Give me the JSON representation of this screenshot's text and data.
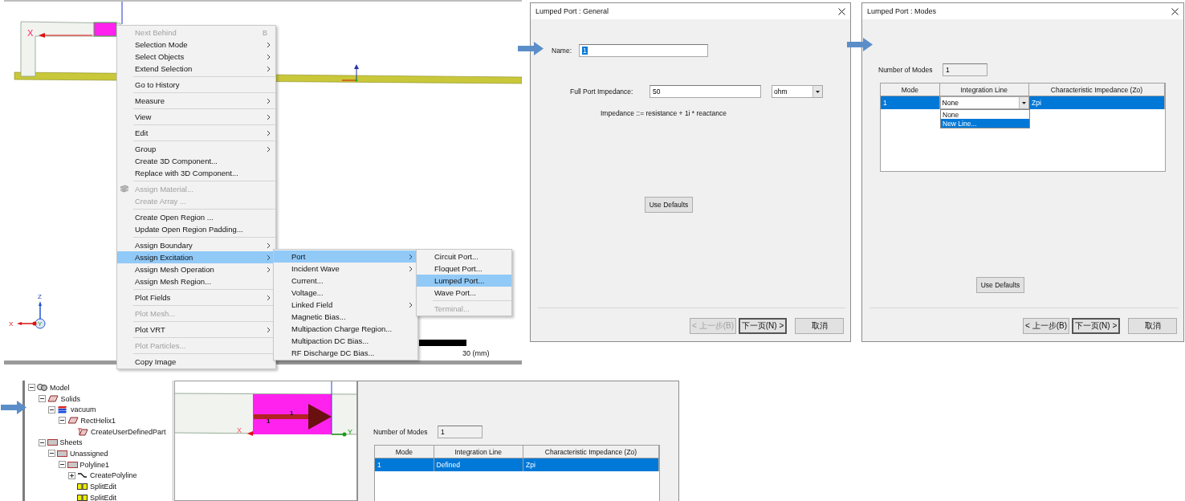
{
  "viewport": {
    "model_axis_label": "X",
    "triad_labels": [
      "Z",
      "X",
      "Y"
    ],
    "scale_label": "30 (mm)"
  },
  "context_menu": {
    "items": [
      {
        "kind": "item",
        "label": "Next Behind",
        "shortcut": "B",
        "disabled": true,
        "submenu": false,
        "selected": false
      },
      {
        "kind": "item",
        "label": "Selection Mode",
        "disabled": false,
        "submenu": true,
        "selected": false
      },
      {
        "kind": "item",
        "label": "Select Objects",
        "disabled": false,
        "submenu": true,
        "selected": false
      },
      {
        "kind": "item",
        "label": "Extend Selection",
        "disabled": false,
        "submenu": true,
        "selected": false
      },
      {
        "kind": "separator"
      },
      {
        "kind": "item",
        "label": "Go to History",
        "disabled": false,
        "submenu": false,
        "selected": false
      },
      {
        "kind": "separator"
      },
      {
        "kind": "item",
        "label": "Measure",
        "disabled": false,
        "submenu": true,
        "selected": false
      },
      {
        "kind": "separator"
      },
      {
        "kind": "item",
        "label": "View",
        "disabled": false,
        "submenu": true,
        "selected": false
      },
      {
        "kind": "separator"
      },
      {
        "kind": "item",
        "label": "Edit",
        "disabled": false,
        "submenu": true,
        "selected": false
      },
      {
        "kind": "separator"
      },
      {
        "kind": "item",
        "label": "Group",
        "disabled": false,
        "submenu": true,
        "selected": false
      },
      {
        "kind": "item",
        "label": "Create 3D Component...",
        "disabled": false,
        "submenu": false,
        "selected": false
      },
      {
        "kind": "item",
        "label": "Replace with 3D Component...",
        "disabled": false,
        "submenu": false,
        "selected": false
      },
      {
        "kind": "separator"
      },
      {
        "kind": "icon_item",
        "label": "Assign Material...",
        "disabled": true,
        "submenu": false,
        "selected": false
      },
      {
        "kind": "item",
        "label": "Create Array ...",
        "disabled": true,
        "submenu": false,
        "selected": false
      },
      {
        "kind": "separator"
      },
      {
        "kind": "item",
        "label": "Create Open Region ...",
        "disabled": false,
        "submenu": false,
        "selected": false
      },
      {
        "kind": "item",
        "label": "Update Open Region Padding...",
        "disabled": false,
        "submenu": false,
        "selected": false
      },
      {
        "kind": "separator"
      },
      {
        "kind": "item",
        "label": "Assign Boundary",
        "disabled": false,
        "submenu": true,
        "selected": false
      },
      {
        "kind": "item",
        "label": "Assign Excitation",
        "disabled": false,
        "submenu": true,
        "selected": true
      },
      {
        "kind": "item",
        "label": "Assign Mesh Operation",
        "disabled": false,
        "submenu": true,
        "selected": false
      },
      {
        "kind": "item",
        "label": "Assign Mesh Region...",
        "disabled": false,
        "submenu": false,
        "selected": false
      },
      {
        "kind": "separator"
      },
      {
        "kind": "item",
        "label": "Plot Fields",
        "disabled": false,
        "submenu": true,
        "selected": false
      },
      {
        "kind": "separator"
      },
      {
        "kind": "item",
        "label": "Plot Mesh...",
        "disabled": true,
        "submenu": false,
        "selected": false
      },
      {
        "kind": "separator"
      },
      {
        "kind": "item",
        "label": "Plot VRT",
        "disabled": false,
        "submenu": true,
        "selected": false
      },
      {
        "kind": "separator"
      },
      {
        "kind": "item",
        "label": "Plot Particles...",
        "disabled": true,
        "submenu": false,
        "selected": false
      },
      {
        "kind": "separator"
      },
      {
        "kind": "item",
        "label": "Copy Image",
        "disabled": false,
        "submenu": false,
        "selected": false
      }
    ]
  },
  "excitation_submenu": {
    "items": [
      {
        "kind": "item",
        "label": "Port",
        "disabled": false,
        "submenu": true,
        "selected": true
      },
      {
        "kind": "item",
        "label": "Incident Wave",
        "disabled": false,
        "submenu": true,
        "selected": false
      },
      {
        "kind": "item",
        "label": "Current...",
        "disabled": false,
        "submenu": false,
        "selected": false
      },
      {
        "kind": "item",
        "label": "Voltage...",
        "disabled": false,
        "submenu": false,
        "selected": false
      },
      {
        "kind": "item",
        "label": "Linked Field",
        "disabled": false,
        "submenu": true,
        "selected": false
      },
      {
        "kind": "item",
        "label": "Magnetic Bias...",
        "disabled": false,
        "submenu": false,
        "selected": false
      },
      {
        "kind": "item",
        "label": "Multipaction Charge Region...",
        "disabled": false,
        "submenu": false,
        "selected": false
      },
      {
        "kind": "item",
        "label": "Multipaction DC Bias...",
        "disabled": false,
        "submenu": false,
        "selected": false
      },
      {
        "kind": "item",
        "label": "RF Discharge DC Bias...",
        "disabled": false,
        "submenu": false,
        "selected": false
      }
    ]
  },
  "port_submenu": {
    "items": [
      {
        "kind": "item",
        "label": "Circuit Port...",
        "disabled": false,
        "submenu": false,
        "selected": false
      },
      {
        "kind": "item",
        "label": "Floquet Port...",
        "disabled": false,
        "submenu": false,
        "selected": false
      },
      {
        "kind": "item",
        "label": "Lumped Port...",
        "disabled": false,
        "submenu": false,
        "selected": true
      },
      {
        "kind": "item",
        "label": "Wave Port...",
        "disabled": false,
        "submenu": false,
        "selected": false
      },
      {
        "kind": "separator"
      },
      {
        "kind": "item",
        "label": "Terminal...",
        "disabled": true,
        "submenu": false,
        "selected": false
      }
    ]
  },
  "general_dialog": {
    "title": "Lumped Port : General",
    "name_label": "Name:",
    "name_value": "1",
    "name_text_selected": true,
    "impedance_label": "Full Port Impedance:",
    "impedance_value": "50",
    "unit": "ohm",
    "formula": "Impedance ::= resistance + 1i * reactance",
    "defaults_button": "Use Defaults",
    "buttons": [
      {
        "label": "< 上一步(B)",
        "disabled": true,
        "default": false
      },
      {
        "label": "下一页(N) >",
        "disabled": false,
        "default": true
      },
      {
        "label": "取消",
        "disabled": false,
        "default": false
      }
    ]
  },
  "modes_dialog": {
    "title": "Lumped Port : Modes",
    "modes_label": "Number of Modes",
    "modes_value": "1",
    "columns": [
      "Mode",
      "Integration Line",
      "Characteristic Impedance (Zo)"
    ],
    "rows": [
      {
        "selected": true,
        "cells": [
          {
            "kind": "text",
            "text": "1"
          },
          {
            "kind": "dropdown",
            "text": "None"
          },
          {
            "kind": "text",
            "text": "Zpi"
          }
        ]
      }
    ],
    "dropdown_options": [
      {
        "label": "None",
        "selected": false
      },
      {
        "label": "New Line...",
        "selected": true
      }
    ],
    "defaults_button": "Use Defaults",
    "buttons": [
      {
        "label": "< 上一步(B)",
        "disabled": false,
        "default": false
      },
      {
        "label": "下一页(N) >",
        "disabled": false,
        "default": true
      },
      {
        "label": "取消",
        "disabled": false,
        "default": false
      }
    ]
  },
  "model_tree": {
    "nodes": [
      {
        "kind": "model",
        "label": "Model",
        "expanded": true,
        "children": [
          {
            "kind": "solid",
            "label": "Solids",
            "expanded": true,
            "children": [
              {
                "kind": "material",
                "label": "vacuum",
                "expanded": true,
                "children": [
                  {
                    "kind": "solid",
                    "label": "RectHelix1",
                    "expanded": true,
                    "children": [
                      {
                        "kind": "operation",
                        "label": "CreateUserDefinedPart"
                      }
                    ]
                  }
                ]
              }
            ]
          },
          {
            "kind": "sheet",
            "label": "Sheets",
            "expanded": true,
            "children": [
              {
                "kind": "sheet",
                "label": "Unassigned",
                "expanded": true,
                "children": [
                  {
                    "kind": "sheet",
                    "label": "Polyline1",
                    "expanded": true,
                    "children": [
                      {
                        "kind": "polyline",
                        "label": "CreatePolyline",
                        "expanded": false
                      },
                      {
                        "kind": "edit",
                        "label": "SplitEdit"
                      },
                      {
                        "kind": "edit",
                        "label": "SplitEdit"
                      }
                    ]
                  }
                ]
              }
            ]
          }
        ]
      }
    ]
  },
  "port_view": {
    "port_labels": [
      "1",
      "1"
    ],
    "axis_labels": [
      "X",
      "Y"
    ]
  },
  "defined_modes": {
    "modes_label": "Number of Modes",
    "modes_value": "1",
    "columns": [
      "Mode",
      "Integration Line",
      "Characteristic Impedance (Zo)"
    ],
    "rows": [
      {
        "selected": true,
        "cells": [
          {
            "kind": "text",
            "text": "1"
          },
          {
            "kind": "text",
            "text": "Defined"
          },
          {
            "kind": "text",
            "text": "Zpi"
          }
        ]
      }
    ]
  }
}
